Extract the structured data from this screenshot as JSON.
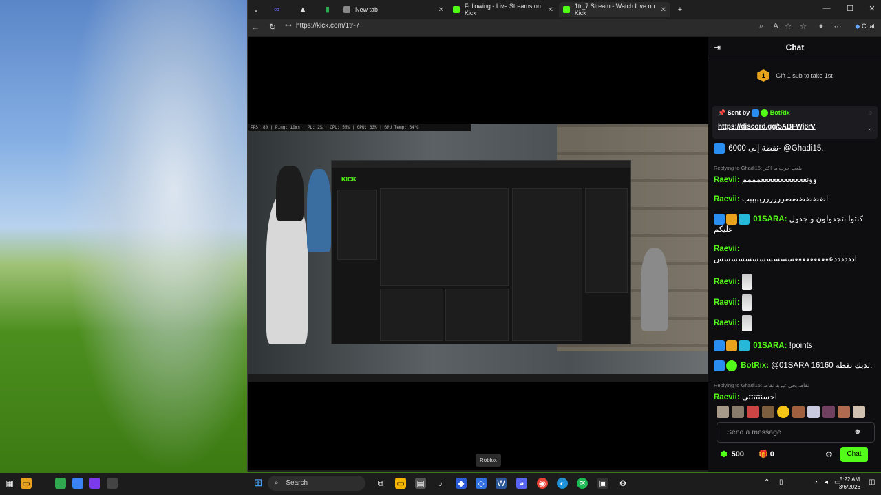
{
  "browser": {
    "tabs": [
      {
        "label": "New tab"
      },
      {
        "label": "Following - Live Streams on Kick"
      },
      {
        "label": "1tr_7 Stream - Watch Live on Kick"
      }
    ],
    "url": "https://kick.com/1tr-7",
    "copilot_label": "Chat"
  },
  "video": {
    "tooltip": "Roblox",
    "inner_brand": "KICK"
  },
  "chat": {
    "title": "Chat",
    "gift_count": "1",
    "gift_text": "Gift 1 sub to take 1st",
    "pinned": {
      "sent_by": "Sent by",
      "bot": "BotRix",
      "link": "https://discord.gg/5ABFWj8rV"
    },
    "messages": [
      {
        "text": "نقطة إلى 6000- @Ghadi15."
      },
      {
        "reply": "Replying to Ghadi15: يلعب حرب ما اكثر",
        "user": "Raevii",
        "text": "وونععععععععععععمممم"
      },
      {
        "user": "Raevii",
        "text": "اضضضضضضرررررربببببب"
      },
      {
        "user": "01SARA",
        "text": "كنتوا بتجدولون و جدول عليكم"
      },
      {
        "user": "Raevii",
        "text": "اددددددععععععععععسسسسسسسسسسس"
      },
      {
        "user": "Raevii"
      },
      {
        "user": "Raevii"
      },
      {
        "user": "Raevii"
      },
      {
        "user": "01SARA",
        "text": "!points"
      },
      {
        "user": "BotRix",
        "text": "@01SARA 16160 لديك نقطة."
      },
      {
        "reply": "Replying to Ghadi15: نقاط يجي غيرها نقاط",
        "user": "Raevii",
        "text": "احسنتتتتتي"
      }
    ],
    "input_placeholder": "Send a message",
    "points": "500",
    "gifts": "0",
    "chat_button": "Chat"
  },
  "taskbar": {
    "search": "Search",
    "time": "5:22 AM",
    "date": "3/6/2026"
  }
}
